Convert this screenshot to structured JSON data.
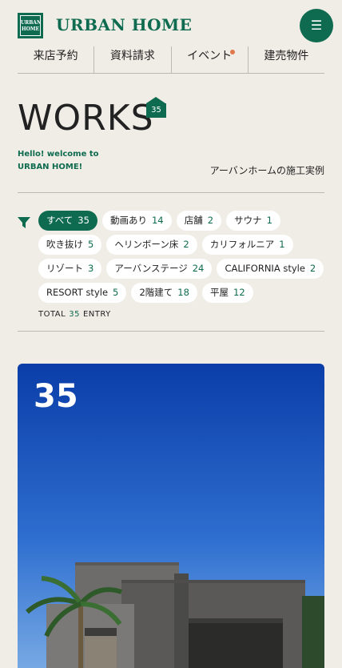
{
  "header": {
    "logo_text": "URBAN HOME",
    "brand": "URBAN HOME",
    "menu_icon": "menu-icon"
  },
  "nav": [
    {
      "label": "来店予約"
    },
    {
      "label": "資料請求"
    },
    {
      "label": "イベント"
    },
    {
      "label": "建売物件"
    }
  ],
  "title": {
    "text": "WORKS",
    "count": "35"
  },
  "hello": {
    "line1": "Hello! welcome to",
    "line2": "URBAN HOME!"
  },
  "subtitle": "アーバンホームの施工実例",
  "filter": {
    "icon": "filter-icon",
    "tags": [
      {
        "label": "すべて",
        "count": "35",
        "active": true
      },
      {
        "label": "動画あり",
        "count": "14"
      },
      {
        "label": "店舗",
        "count": "2"
      },
      {
        "label": "サウナ",
        "count": "1"
      },
      {
        "label": "吹き抜け",
        "count": "5"
      },
      {
        "label": "ヘリンボーン床",
        "count": "2"
      },
      {
        "label": "カリフォルニア",
        "count": "1"
      },
      {
        "label": "リゾート",
        "count": "3"
      },
      {
        "label": "アーバンステージ",
        "count": "24"
      },
      {
        "label": "CALIFORNIA style",
        "count": "2"
      },
      {
        "label": "RESORT style",
        "count": "5"
      },
      {
        "label": "2階建て",
        "count": "18"
      },
      {
        "label": "平屋",
        "count": "12"
      }
    ],
    "total_prefix": "TOTAL",
    "total_count": "35",
    "total_suffix": "ENTRY"
  },
  "card": {
    "number": "35"
  },
  "colors": {
    "accent": "#0e6b4f",
    "background": "#f0ede6",
    "dot": "#e1784b"
  }
}
